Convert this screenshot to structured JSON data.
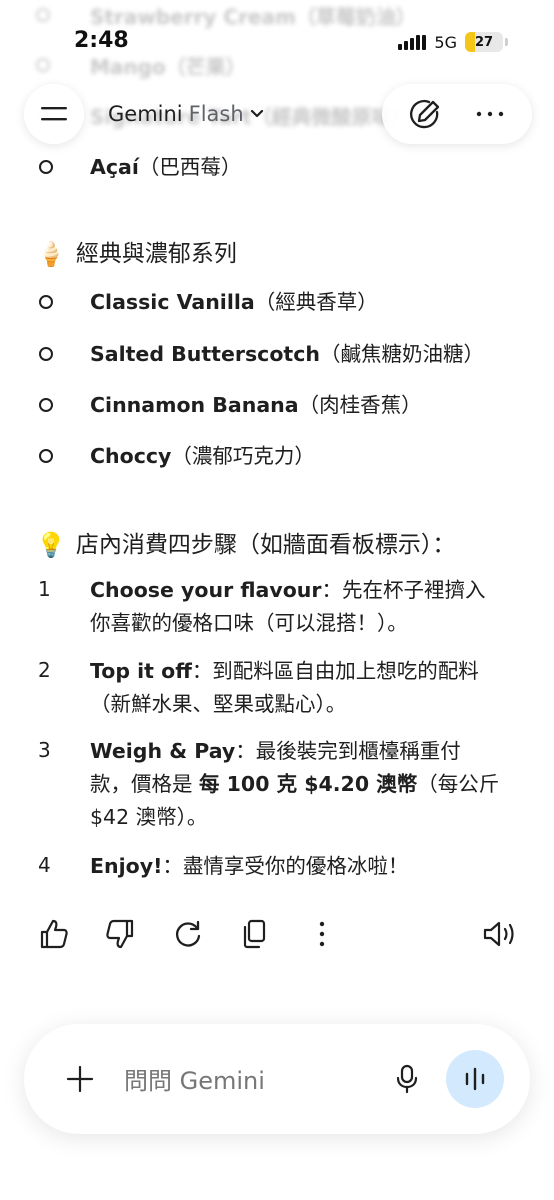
{
  "status_bar": {
    "time": "2:48",
    "network": "5G",
    "battery_level": "27",
    "battery_color": "#f5c518"
  },
  "header": {
    "menu_icon": "hamburger-menu-icon",
    "model_brand": "Gemini",
    "model_variant": "Flash",
    "dropdown_icon": "chevron-down-icon",
    "new_chat_icon": "edit-pen-icon",
    "more_icon": "more-horizontal-icon"
  },
  "background_items": [
    "Strawberry Cream（草莓奶油）",
    "Mango（芒果）",
    "Signature Tart（經典微酸原味）"
  ],
  "flavours_top": [
    {
      "name": "Açaí",
      "desc": "（巴西莓）"
    }
  ],
  "classic_section": {
    "emoji": "🍦",
    "title": "經典與濃郁系列",
    "items": [
      {
        "name": "Classic Vanilla",
        "desc": "（經典香草）"
      },
      {
        "name": "Salted Butterscotch",
        "desc": "（鹹焦糖奶油糖）"
      },
      {
        "name": "Cinnamon Banana",
        "desc": "（肉桂香蕉）"
      },
      {
        "name": "Choccy",
        "desc": "（濃郁巧克力）"
      }
    ]
  },
  "steps_section": {
    "emoji": "💡",
    "title": "店內消費四步驟（如牆面看板標示）：",
    "steps": [
      {
        "num": "1",
        "name": "Choose your flavour",
        "line1": "：先在杯子裡擠入",
        "line2": "你喜歡的優格口味（可以混搭！）。"
      },
      {
        "num": "2",
        "name": "Top it off",
        "line1": "：到配料區自由加上想吃的配料",
        "line2": "（新鮮水果、堅果或點心）。"
      },
      {
        "num": "3",
        "name": "Weigh & Pay",
        "line1": "：最後裝完到櫃檯稱重付",
        "line2a": "款，價格是 ",
        "price": "每 100 克 $4.20 澳幣",
        "line2b": "（每公斤",
        "line3": "$42 澳幣）。"
      },
      {
        "num": "4",
        "name": "Enjoy!",
        "line1": "：盡情享受你的優格冰啦！"
      }
    ]
  },
  "response_actions": {
    "icons": [
      "thumbs-up-icon",
      "thumbs-down-icon",
      "regenerate-icon",
      "copy-icon",
      "more-vertical-icon",
      "read-aloud-icon"
    ]
  },
  "input": {
    "placeholder": "問問 Gemini",
    "live_button_color": "#d3e9fd"
  }
}
